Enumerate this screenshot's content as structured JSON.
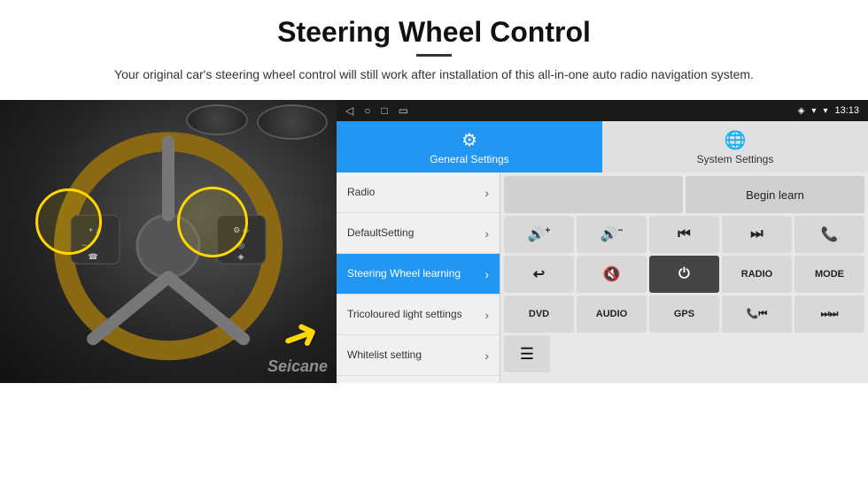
{
  "header": {
    "title": "Steering Wheel Control",
    "subtitle": "Your original car's steering wheel control will still work after installation of this all-in-one auto radio navigation system."
  },
  "statusBar": {
    "time": "13:13",
    "navIcons": [
      "◁",
      "○",
      "□",
      "▭"
    ]
  },
  "tabs": {
    "general": {
      "label": "General Settings",
      "icon": "⚙"
    },
    "system": {
      "label": "System Settings",
      "icon": "🌐"
    }
  },
  "menuItems": [
    {
      "label": "Radio",
      "active": false
    },
    {
      "label": "DefaultSetting",
      "active": false
    },
    {
      "label": "Steering Wheel learning",
      "active": true
    },
    {
      "label": "Tricoloured light settings",
      "active": false
    },
    {
      "label": "Whitelist setting",
      "active": false
    }
  ],
  "buttons": {
    "beginLearn": "Begin learn",
    "row1": [
      "🔊+",
      "🔊−",
      "⏮",
      "⏭",
      "📞"
    ],
    "row2": [
      "↩",
      "🔊✕",
      "⏻",
      "RADIO",
      "MODE"
    ],
    "row3": [
      "DVD",
      "AUDIO",
      "GPS",
      "📞⏮",
      "⏭⏭"
    ],
    "row4": [
      "≡"
    ]
  },
  "watermark": "Seicane"
}
